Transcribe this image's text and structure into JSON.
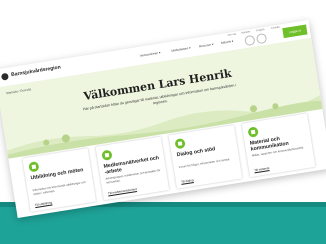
{
  "site": {
    "brand": "Barnsjukvårdsregion"
  },
  "nav": {
    "items": [
      "Verksamheter ▾",
      "Medarbetare ▾",
      "Resurser ▾",
      "Nätverk ▾"
    ],
    "util": [
      "Om oss",
      "Nyheter",
      "English",
      "Kontakt"
    ],
    "button": "Logga ut"
  },
  "hero": {
    "breadcrumb": "Startsida / Översikt",
    "title": "Välkommen Lars Henrik",
    "subtitle": "Här på startsidan hittar du genvägar till material, utbildningar och information om barnsjukvården i regionen."
  },
  "cards": [
    {
      "title": "Utbildning och möten",
      "desc": "Information om kommande utbildningar och möten i nätverket.",
      "link": "Till utbildning"
    },
    {
      "title": "Medlemsnätverket och -arbete",
      "desc": "Arbetsgrupper, medlemmar och kontakter för samverkan.",
      "link": "Till medlemsnätverket"
    },
    {
      "title": "Dialog och stöd",
      "desc": "Forum för frågor, erfarenheter och samtal.",
      "link": "Till dialog"
    },
    {
      "title": "Material och kommunikation",
      "desc": "Mallar, rapporter och kommunikationsstöd.",
      "link": "Till material"
    }
  ],
  "colors": {
    "accent": "#6fbf2a",
    "band": "#1ea398",
    "hero_bg": "#eef6df"
  }
}
